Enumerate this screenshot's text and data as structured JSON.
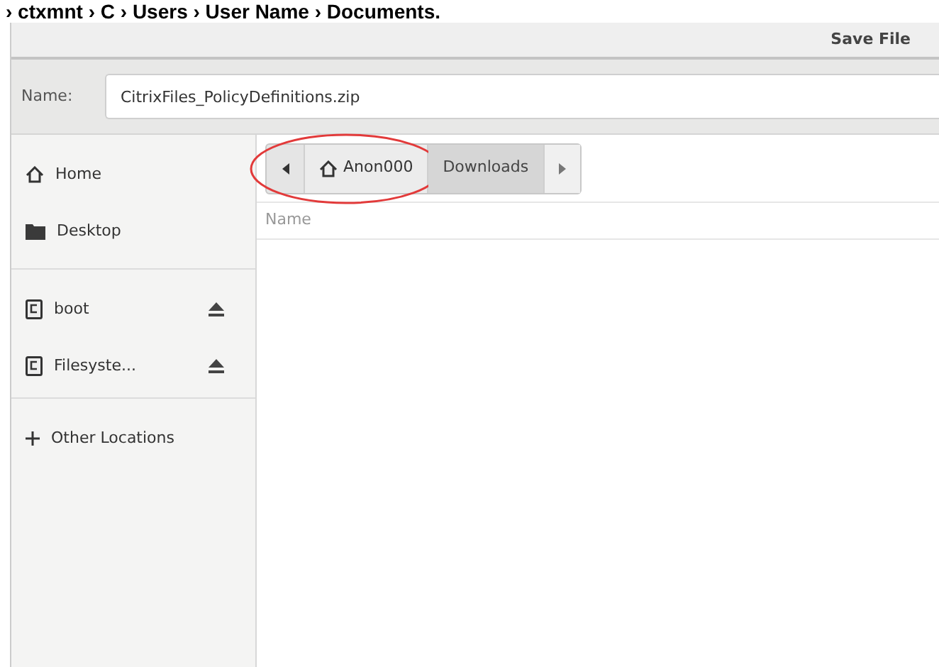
{
  "caption": "› ctxmnt › C › Users › User Name › Documents.",
  "window": {
    "title": "Save File"
  },
  "name_field": {
    "label": "Name:",
    "value": "CitrixFiles_PolicyDefinitions.zip"
  },
  "sidebar": {
    "groups": [
      {
        "items": [
          {
            "label": "Home",
            "kind": "home"
          },
          {
            "label": "Desktop",
            "kind": "folder"
          }
        ]
      },
      {
        "items": [
          {
            "label": "boot",
            "kind": "drive"
          },
          {
            "label": "Filesyste...",
            "kind": "drive"
          }
        ]
      },
      {
        "items": [
          {
            "label": "Other Locations",
            "kind": "other"
          }
        ]
      }
    ]
  },
  "path_bar": {
    "segments": [
      {
        "label": "Anon000",
        "kind": "home",
        "selected": false,
        "highlighted": true
      },
      {
        "label": "Downloads",
        "kind": "folder",
        "selected": true,
        "highlighted": false
      }
    ]
  },
  "file_list": {
    "columns": [
      "Name"
    ]
  }
}
